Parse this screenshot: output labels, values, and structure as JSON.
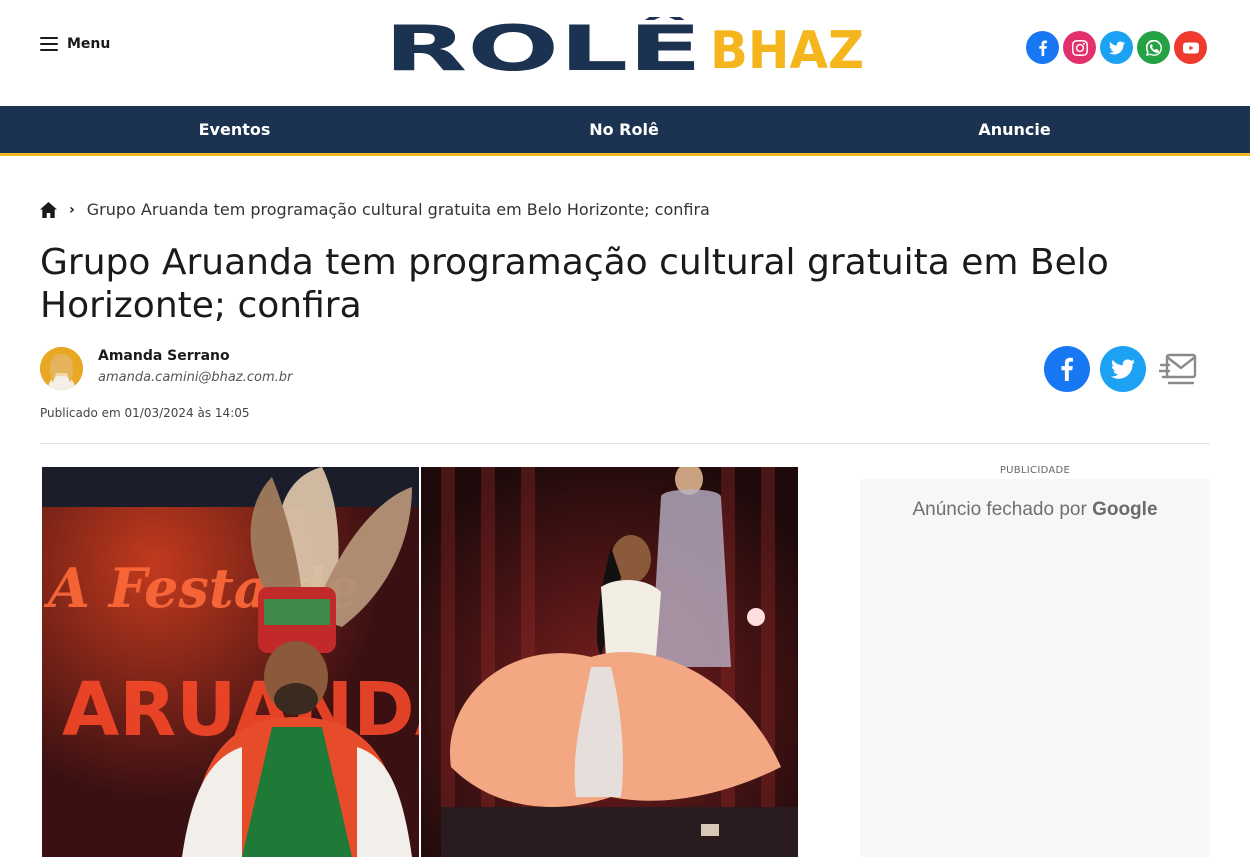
{
  "header": {
    "menu_label": "Menu",
    "logo_part1": "ROLÊ",
    "logo_part2": "BHAZ",
    "socials": [
      {
        "name": "facebook",
        "color": "#1877f2"
      },
      {
        "name": "instagram",
        "color": "#e1306c"
      },
      {
        "name": "twitter",
        "color": "#1da1f2"
      },
      {
        "name": "whatsapp",
        "color": "#25a244"
      },
      {
        "name": "youtube",
        "color": "#ef3b2d"
      }
    ]
  },
  "nav": {
    "items": [
      "Eventos",
      "No Rolê",
      "Anuncie"
    ]
  },
  "breadcrumb": {
    "current": "Grupo Aruanda tem programação cultural gratuita em Belo Horizonte; confira"
  },
  "article": {
    "title": "Grupo Aruanda tem programação cultural gratuita em Belo Horizonte; confira",
    "author_name": "Amanda Serrano",
    "author_email": "amanda.camini@bhaz.com.br",
    "published": "Publicado em 01/03/2024 às 14:05"
  },
  "photo": {
    "sign_line1": "A Festa de",
    "sign_line2": "ARUANDA"
  },
  "ad": {
    "label": "PUBLICIDADE",
    "text": "Anúncio fechado por",
    "brand": "Google"
  },
  "colors": {
    "nav_bg": "#1b3350",
    "accent": "#f5b51c",
    "logo_dark": "#1b3350"
  }
}
